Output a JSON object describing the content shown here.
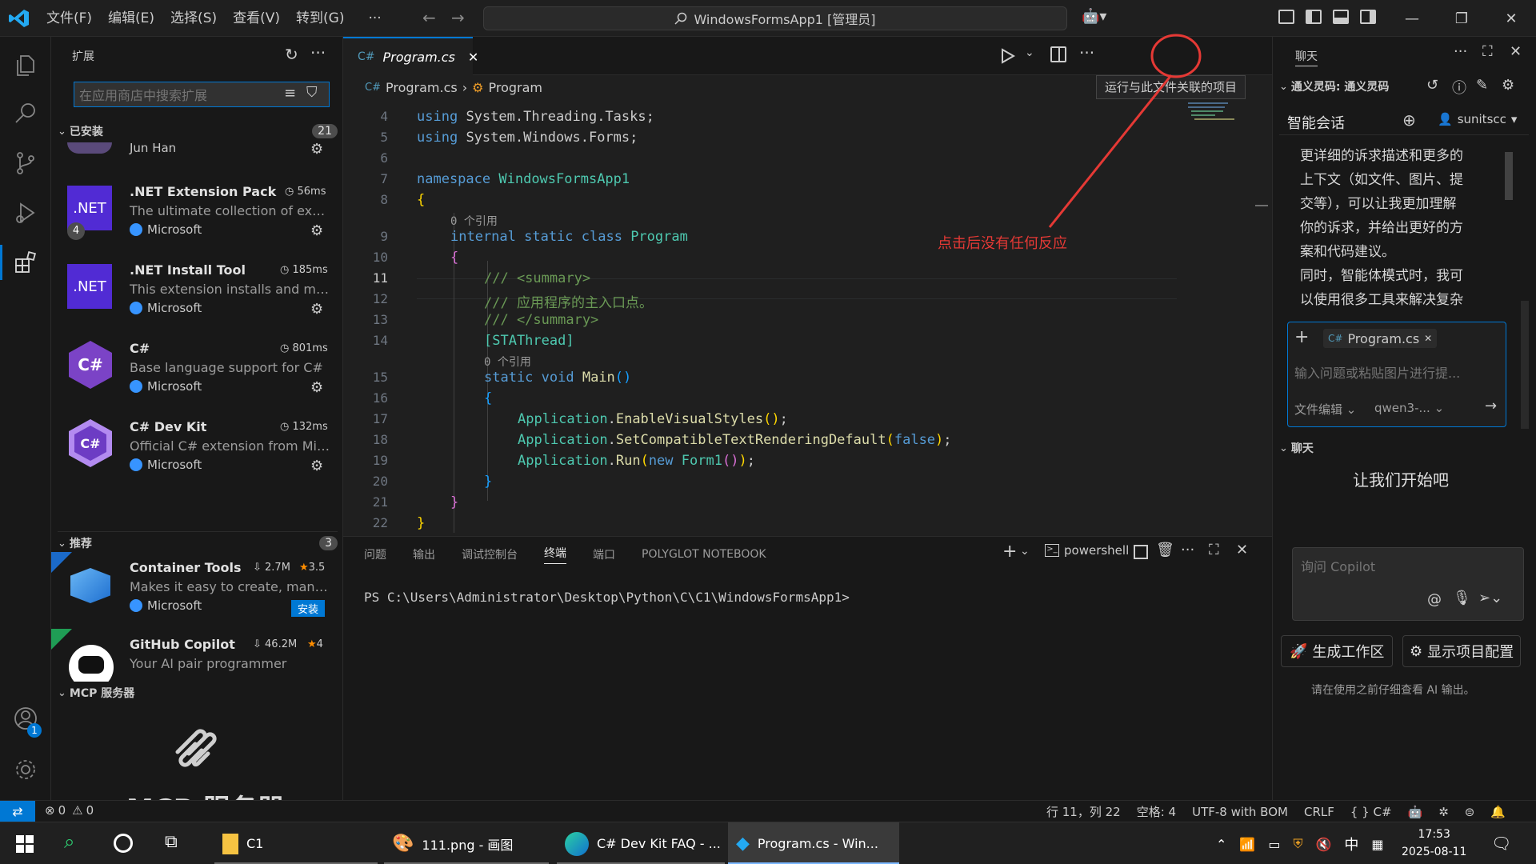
{
  "titlebar": {
    "menus": [
      "文件(F)",
      "编辑(E)",
      "选择(S)",
      "查看(V)",
      "转到(G)"
    ],
    "more": "···",
    "search": "WindowsFormsApp1 [管理员]"
  },
  "sidebar": {
    "title": "扩展",
    "search_placeholder": "在应用商店中搜索扩展",
    "installed": {
      "label": "已安装",
      "count": "21",
      "partial_publisher": "Jun Han",
      "items": [
        {
          "name": ".NET Extension Pack",
          "time": "56ms",
          "desc": "The ultimate collection of exte...",
          "publisher": "Microsoft",
          "icon": ".NET",
          "icon_badge": "4"
        },
        {
          "name": ".NET Install Tool",
          "time": "185ms",
          "desc": "This extension installs and ma...",
          "publisher": "Microsoft",
          "icon": ".NET"
        },
        {
          "name": "C#",
          "time": "801ms",
          "desc": "Base language support for C#",
          "publisher": "Microsoft",
          "icon": "C#"
        },
        {
          "name": "C# Dev Kit",
          "time": "132ms",
          "desc": "Official C# extension from Mic...",
          "publisher": "Microsoft",
          "icon": "C#"
        }
      ]
    },
    "recommended": {
      "label": "推荐",
      "count": "3",
      "items": [
        {
          "name": "Container Tools",
          "downloads": "2.7M",
          "rating": "3.5",
          "desc": "Makes it easy to create, mana...",
          "publisher": "Microsoft",
          "install": "安装"
        },
        {
          "name": "GitHub Copilot",
          "downloads": "46.2M",
          "rating": "4",
          "desc": "Your AI pair programmer"
        }
      ]
    },
    "mcp": {
      "label": "MCP 服务器",
      "title": "MCP 服务器"
    }
  },
  "editor": {
    "tab": "Program.cs",
    "breadcrumb": [
      "Program.cs",
      "Program"
    ],
    "tooltip": "运行与此文件关联的项目",
    "annotation": "点击后没有任何反应",
    "lines": [
      {
        "n": "4",
        "t": "using System.Threading.Tasks;"
      },
      {
        "n": "5",
        "t": "using System.Windows.Forms;"
      },
      {
        "n": "6",
        "t": ""
      },
      {
        "n": "7",
        "t": "namespace WindowsFormsApp1"
      },
      {
        "n": "8",
        "t": "{"
      },
      {
        "n": "9",
        "t": "internal static class Program"
      },
      {
        "n": "10",
        "t": "{"
      },
      {
        "n": "11",
        "t": "/// <summary>"
      },
      {
        "n": "12",
        "t": "/// 应用程序的主入口点。"
      },
      {
        "n": "13",
        "t": "/// </summary>"
      },
      {
        "n": "14",
        "t": "[STAThread]"
      },
      {
        "n": "15",
        "t": "static void Main()"
      },
      {
        "n": "16",
        "t": "{"
      },
      {
        "n": "17",
        "t": "Application.EnableVisualStyles();"
      },
      {
        "n": "18",
        "t": "Application.SetCompatibleTextRenderingDefault(false);"
      },
      {
        "n": "19",
        "t": "Application.Run(new Form1());"
      },
      {
        "n": "20",
        "t": "}"
      },
      {
        "n": "21",
        "t": "}"
      },
      {
        "n": "22",
        "t": "}"
      }
    ],
    "codelens": "0 个引用"
  },
  "panel": {
    "tabs": [
      "问题",
      "输出",
      "调试控制台",
      "终端",
      "端口",
      "POLYGLOT NOTEBOOK"
    ],
    "active_tab": "终端",
    "shell": "powershell",
    "prompt": "PS C:\\Users\\Administrator\\Desktop\\Python\\C\\C1\\WindowsFormsApp1>"
  },
  "chat": {
    "title": "聊天",
    "section": "通义灵码: 通义灵码",
    "mode": "智能会话",
    "user": "sunitscc",
    "message": [
      "更详细的诉求描述和更多的",
      "上下文（如文件、图片、提",
      "交等），可以让我更加理解",
      "你的诉求，并给出更好的方",
      "案和代码建议。",
      "同时，智能体模式时，我可",
      "以使用很多工具来解决复杂"
    ],
    "context_file": "Program.cs",
    "input_placeholder": "输入问题或粘贴图片进行提...",
    "edit_mode": "文件编辑",
    "model": "qwen3-...",
    "chat_section": "聊天",
    "start": "让我们开始吧",
    "copilot_placeholder": "询问 Copilot",
    "gen_workspace": "生成工作区",
    "show_config": "显示项目配置",
    "disclaimer": "请在使用之前仔细查看 AI 输出。"
  },
  "status": {
    "errors": "0",
    "warnings": "0",
    "position": "行 11，列 22",
    "spaces": "空格: 4",
    "encoding": "UTF-8 with BOM",
    "eol": "CRLF",
    "lang": "C#"
  },
  "taskbar": {
    "items": [
      "C1",
      "111.png - 画图",
      "C# Dev Kit FAQ - ...",
      "Program.cs - Win..."
    ],
    "ime": "中",
    "time": "17:53",
    "date": "2025-08-11"
  },
  "colors": {
    "accent": "#0078d4",
    "annotation": "#e53935",
    "net_purple": "#512bd4",
    "csharp_purple": "#68217a"
  }
}
